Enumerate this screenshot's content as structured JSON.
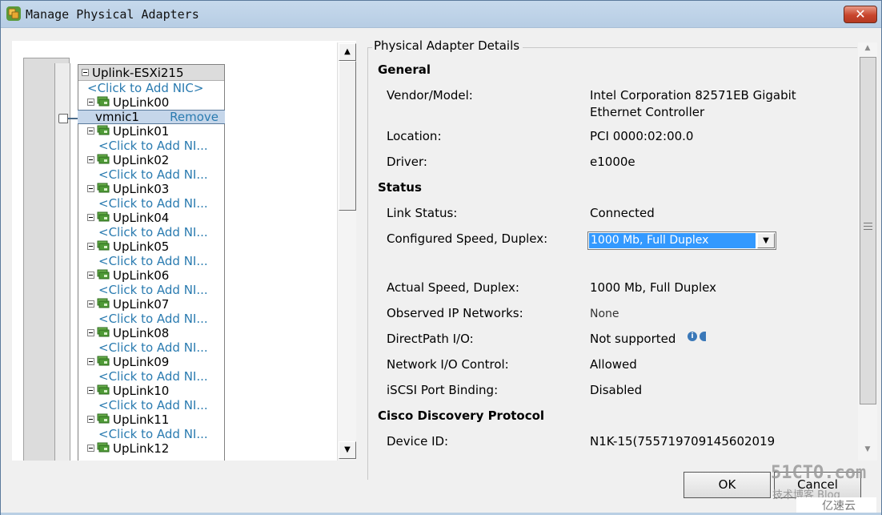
{
  "window": {
    "title": "Manage Physical Adapters",
    "close_icon": "close-icon"
  },
  "switch": {
    "name": "Uplink-ESXi215",
    "add_nic_label": "<Click to Add NIC>",
    "uplinks": [
      {
        "name": "UpLink00",
        "nic": "vmnic1",
        "remove_label": "Remove",
        "selected": true
      },
      {
        "name": "UpLink01",
        "add_label": "<Click to Add NI..."
      },
      {
        "name": "UpLink02",
        "add_label": "<Click to Add NI..."
      },
      {
        "name": "UpLink03",
        "add_label": "<Click to Add NI..."
      },
      {
        "name": "UpLink04",
        "add_label": "<Click to Add NI..."
      },
      {
        "name": "UpLink05",
        "add_label": "<Click to Add NI..."
      },
      {
        "name": "UpLink06",
        "add_label": "<Click to Add NI..."
      },
      {
        "name": "UpLink07",
        "add_label": "<Click to Add NI..."
      },
      {
        "name": "UpLink08",
        "add_label": "<Click to Add NI..."
      },
      {
        "name": "UpLink09",
        "add_label": "<Click to Add NI..."
      },
      {
        "name": "UpLink10",
        "add_label": "<Click to Add NI..."
      },
      {
        "name": "UpLink11",
        "add_label": "<Click to Add NI..."
      },
      {
        "name": "UpLink12"
      }
    ]
  },
  "details": {
    "group_title": "Physical Adapter Details",
    "general": {
      "title": "General",
      "vendor_label": "Vendor/Model:",
      "vendor_value_line1": "Intel Corporation 82571EB Gigabit",
      "vendor_value_line2": "Ethernet Controller",
      "location_label": "Location:",
      "location_value": "PCI 0000:02:00.0",
      "driver_label": "Driver:",
      "driver_value": "e1000e"
    },
    "status": {
      "title": "Status",
      "link_status_label": "Link Status:",
      "link_status_value": "Connected",
      "configured_speed_label": "Configured Speed, Duplex:",
      "configured_speed_value": "1000 Mb, Full Duplex",
      "actual_speed_label": "Actual Speed, Duplex:",
      "actual_speed_value": "1000 Mb, Full Duplex",
      "observed_ip_label": "Observed IP Networks:",
      "observed_ip_value": "None",
      "directpath_label": "DirectPath I/O:",
      "directpath_value": "Not supported",
      "nioc_label": "Network I/O Control:",
      "nioc_value": "Allowed",
      "iscsi_label": "iSCSI Port Binding:",
      "iscsi_value": "Disabled"
    },
    "cdp": {
      "title": "Cisco Discovery Protocol",
      "device_id_label": "Device ID:",
      "device_id_value": "N1K-15(755719709145602019"
    }
  },
  "buttons": {
    "ok": "OK",
    "cancel": "Cancel"
  },
  "watermark": {
    "site": "51CTO.com",
    "sub": "技术博客 Blog",
    "badge": "亿速云"
  }
}
